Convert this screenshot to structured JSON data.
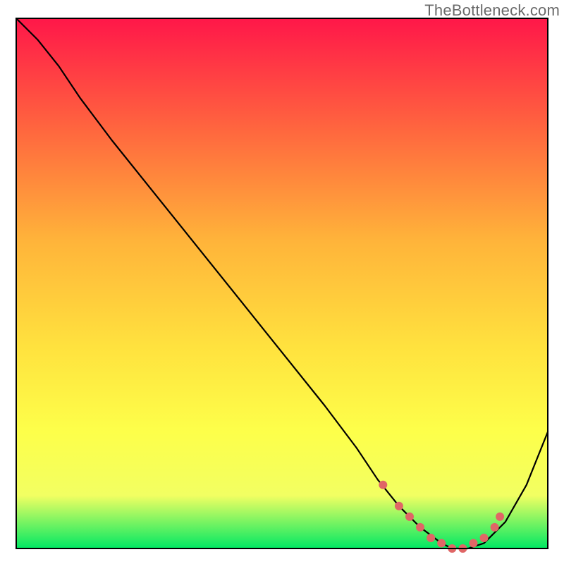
{
  "watermark": {
    "text": "TheBottleneck.com"
  },
  "colors": {
    "grad_top": "#ff1749",
    "grad_mid1": "#ff6a3e",
    "grad_mid2": "#ffb43a",
    "grad_mid3": "#ffe23e",
    "grad_mid4": "#fdff4a",
    "grad_mid5": "#f2ff62",
    "grad_bottom": "#00e863",
    "curve": "#000000",
    "dots": "#e06666",
    "frame": "#000000"
  },
  "chart_data": {
    "type": "line",
    "title": "",
    "xlabel": "",
    "ylabel": "",
    "xlim": [
      0,
      100
    ],
    "ylim": [
      0,
      100
    ],
    "grid": false,
    "legend": false,
    "series": [
      {
        "name": "bottleneck-curve",
        "x": [
          0,
          4,
          8,
          12,
          18,
          26,
          34,
          42,
          50,
          58,
          64,
          68,
          72,
          76,
          80,
          82,
          85,
          88,
          92,
          96,
          100
        ],
        "y": [
          100,
          96,
          91,
          85,
          77,
          67,
          57,
          47,
          37,
          27,
          19,
          13,
          8,
          4,
          1,
          0,
          0,
          1,
          5,
          12,
          22
        ]
      }
    ],
    "highlight_dots": {
      "name": "minimum-region",
      "x": [
        69,
        72,
        74,
        76,
        78,
        80,
        82,
        84,
        86,
        88,
        90,
        91
      ],
      "y": [
        12,
        8,
        6,
        4,
        2,
        1,
        0,
        0,
        1,
        2,
        4,
        6
      ]
    }
  }
}
